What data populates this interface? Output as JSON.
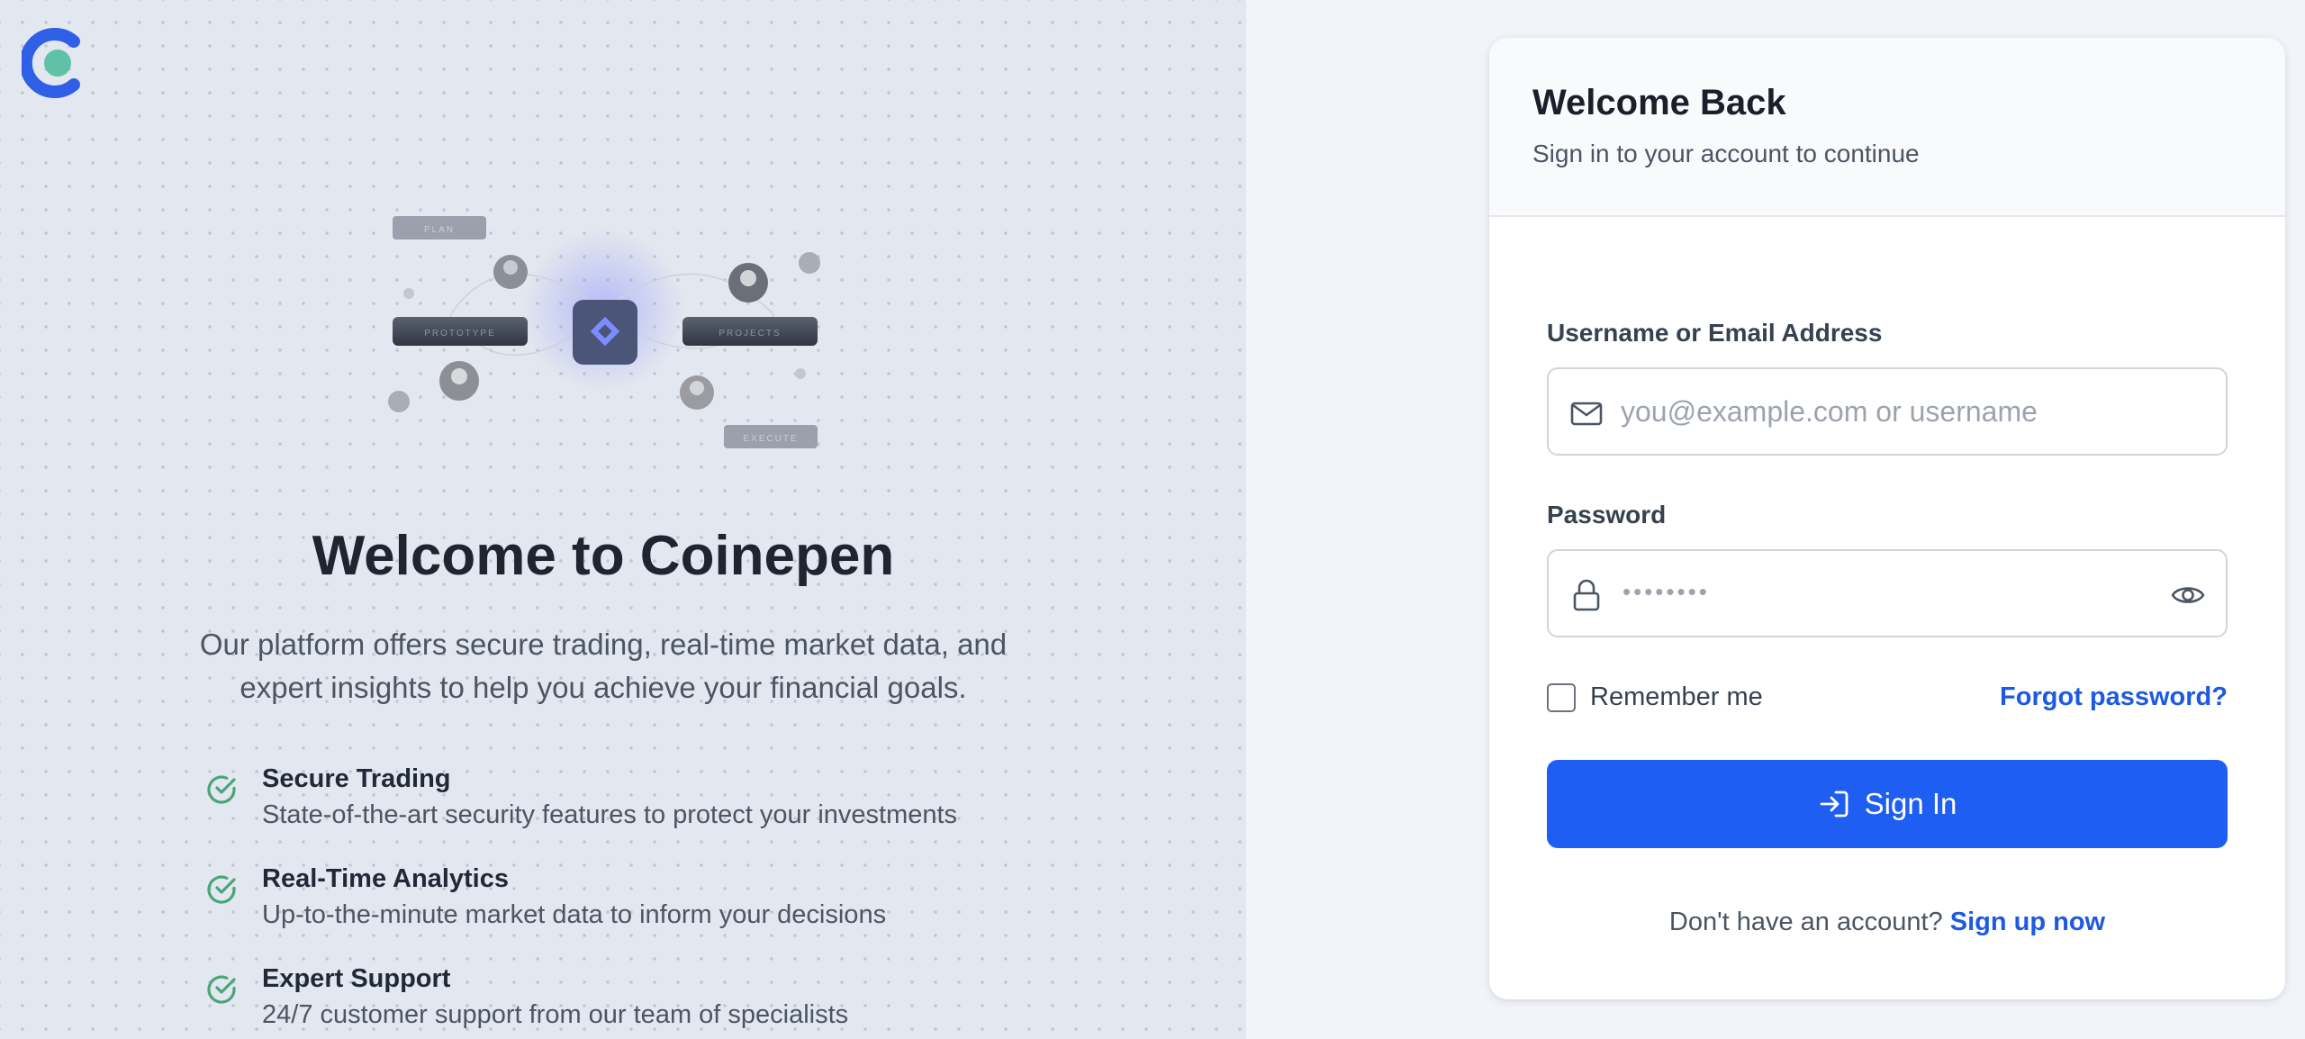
{
  "brand": {
    "logo_icon": "coinepen-logo-icon"
  },
  "welcome": {
    "title": "Welcome to Coinepen",
    "description": "Our platform offers secure trading, real-time market data, and expert insights to help you achieve your financial goals."
  },
  "illustration": {
    "labels": [
      "PLAN",
      "PROTOTYPE",
      "PROJECTS",
      "EXECUTE"
    ]
  },
  "features": [
    {
      "title": "Secure Trading",
      "description": "State-of-the-art security features to protect your investments",
      "icon": "check-circle-icon"
    },
    {
      "title": "Real-Time Analytics",
      "description": "Up-to-the-minute market data to inform your decisions",
      "icon": "check-circle-icon"
    },
    {
      "title": "Expert Support",
      "description": "24/7 customer support from our team of specialists",
      "icon": "check-circle-icon"
    }
  ],
  "login": {
    "title": "Welcome Back",
    "subtitle": "Sign in to your account to continue",
    "username_label": "Username or Email Address",
    "username_placeholder": "you@example.com or username",
    "username_value": "",
    "password_label": "Password",
    "password_mask": "••••••••",
    "remember_label": "Remember me",
    "remember_checked": false,
    "forgot_label": "Forgot password?",
    "signin_label": "Sign In",
    "signup_prompt": "Don't have an account?",
    "signup_link": "Sign up now"
  },
  "colors": {
    "primary": "#1e5ef3",
    "link": "#1d5ae0",
    "check": "#4aa57a",
    "left_bg": "#e3e7ef",
    "right_bg": "#f1f4f9"
  }
}
